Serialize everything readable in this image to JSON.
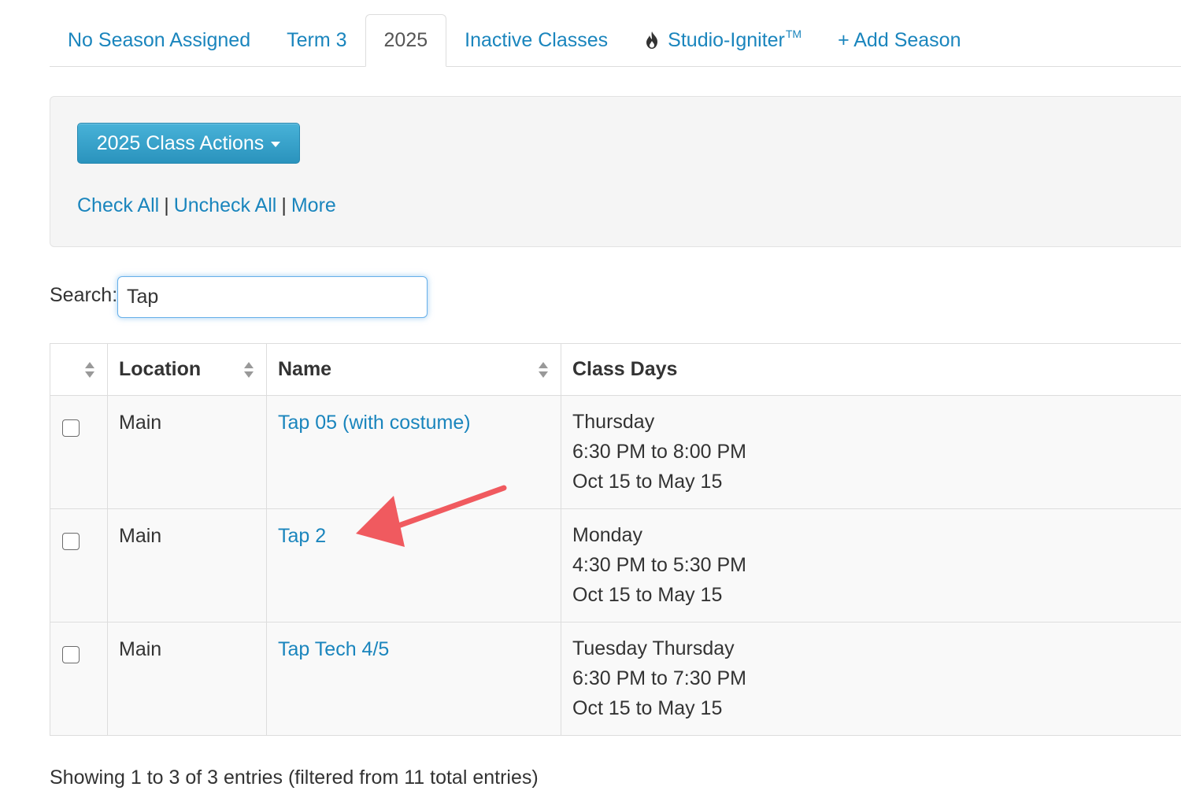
{
  "tabs": [
    {
      "label": "No Season Assigned",
      "active": false
    },
    {
      "label": "Term 3",
      "active": false
    },
    {
      "label": "2025",
      "active": true
    },
    {
      "label": "Inactive Classes",
      "active": false
    },
    {
      "label": "Studio-Igniter",
      "trademark": "TM",
      "icon": "flame-icon",
      "active": false
    },
    {
      "label": "+ Add Season",
      "active": false
    }
  ],
  "actions": {
    "button_label": "2025 Class Actions",
    "check_all": "Check All",
    "separator": "|",
    "uncheck_all": "Uncheck All",
    "more": "More"
  },
  "search": {
    "label": "Search:",
    "value": "Tap"
  },
  "table": {
    "columns": [
      "",
      "Location",
      "Name",
      "Class Days"
    ],
    "rows": [
      {
        "checked": false,
        "location": "Main",
        "name": "Tap 05 (with costume)",
        "days": "Thursday",
        "time": "6:30 PM to 8:00 PM",
        "dates": "Oct 15 to May 15"
      },
      {
        "checked": false,
        "location": "Main",
        "name": "Tap 2",
        "days": "Monday",
        "time": "4:30 PM to 5:30 PM",
        "dates": "Oct 15 to May 15"
      },
      {
        "checked": false,
        "location": "Main",
        "name": "Tap Tech 4/5",
        "days": "Tuesday Thursday",
        "time": "6:30 PM to 7:30 PM",
        "dates": "Oct 15 to May 15"
      }
    ]
  },
  "summary": "Showing 1 to 3 of 3 entries (filtered from 11 total entries)",
  "colors": {
    "link": "#1a85bd",
    "button": "#2a93bd",
    "annotation_arrow": "#f05a5f"
  }
}
